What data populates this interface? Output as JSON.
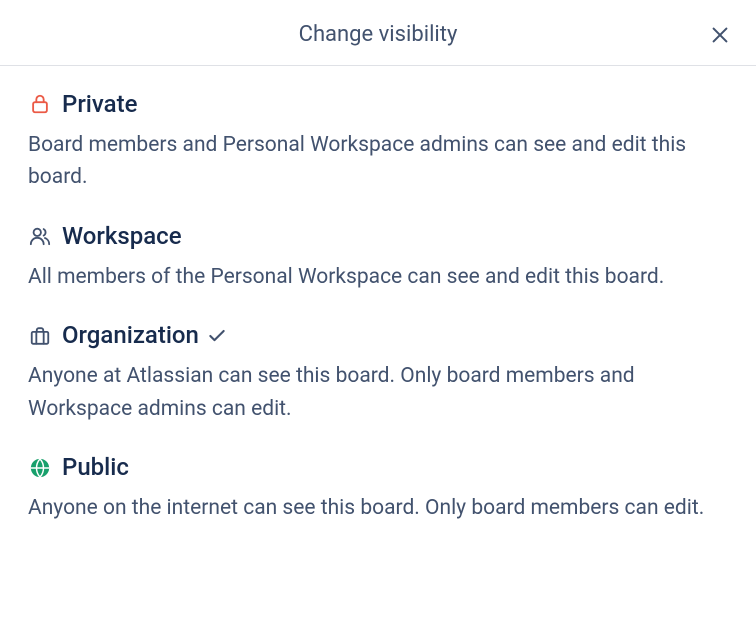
{
  "modal": {
    "title": "Change visibility"
  },
  "options": {
    "private": {
      "title": "Private",
      "description": "Board members and Personal Workspace admins can see and edit this board.",
      "selected": false
    },
    "workspace": {
      "title": "Workspace",
      "description": "All members of the Personal Workspace can see and edit this board.",
      "selected": false
    },
    "organization": {
      "title": "Organization",
      "description": "Anyone at Atlassian can see this board. Only board members and Workspace admins can edit.",
      "selected": true
    },
    "public": {
      "title": "Public",
      "description": "Anyone on the internet can see this board. Only board members can edit.",
      "selected": false
    }
  }
}
